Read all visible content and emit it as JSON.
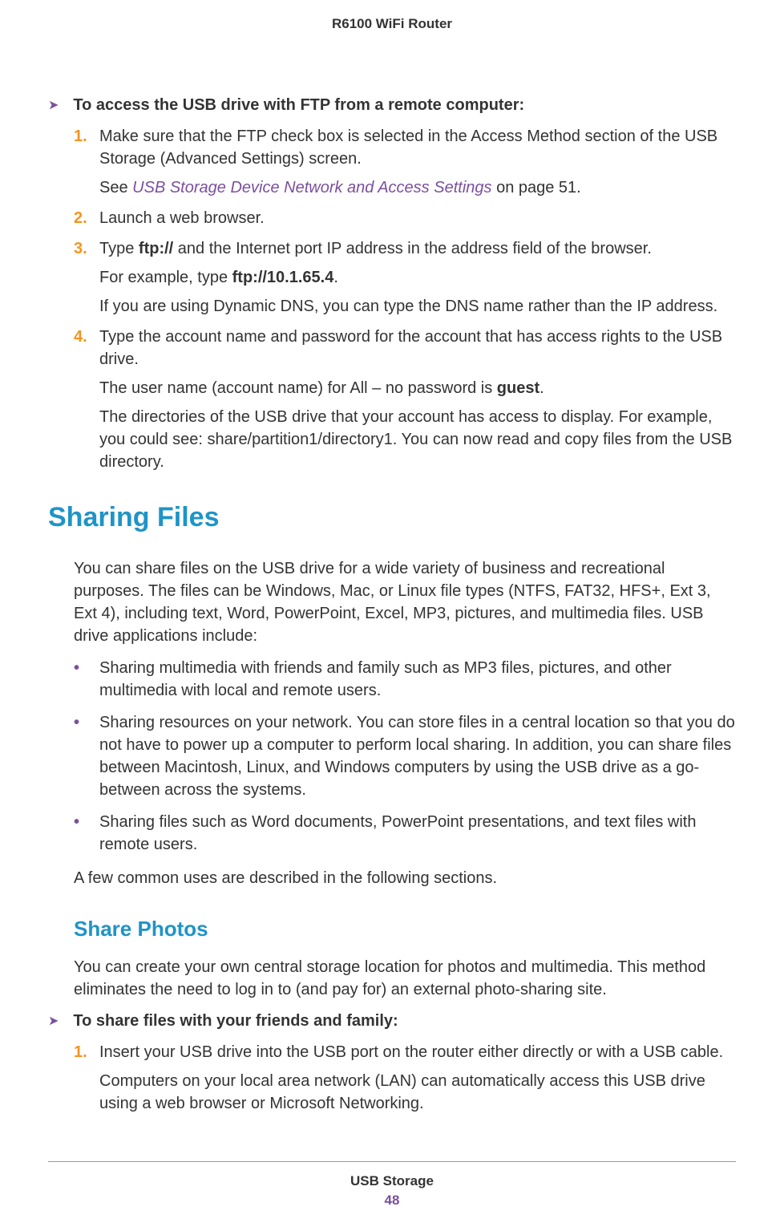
{
  "header": "R6100 WiFi Router",
  "procedure1": {
    "title": "To access the USB drive with FTP from a remote computer:",
    "steps": [
      {
        "num": "1.",
        "text": "Make sure that the FTP check box is selected in the Access Method section of the USB Storage (Advanced Settings) screen.",
        "after": [
          {
            "prefix": "See ",
            "link": "USB Storage Device Network and Access Settings",
            "suffix": " on page 51."
          }
        ]
      },
      {
        "num": "2.",
        "text": "Launch a web browser."
      },
      {
        "num": "3.",
        "pre": "Type ",
        "bold1": "ftp://",
        "post1": " and the Internet port IP address in the address field of the browser.",
        "after_plain": [
          {
            "pre": "For example, type ",
            "bold": "ftp://10.1.65.4",
            "post": "."
          },
          {
            "plain": "If you are using Dynamic DNS, you can type the DNS name rather than the IP address."
          }
        ]
      },
      {
        "num": "4.",
        "text": "Type the account name and password for the account that has access rights to the USB drive.",
        "after_plain": [
          {
            "pre": "The user name (account name) for All – no password is ",
            "bold": "guest",
            "post": "."
          },
          {
            "plain": "The directories of the USB drive that your account has access to display. For example, you could see: share/partition1/directory1. You can now read and copy files from the USB directory."
          }
        ]
      }
    ]
  },
  "h1": "Sharing Files",
  "sharing_intro": "You can share files on the USB drive for a wide variety of business and recreational purposes. The files can be Windows, Mac, or Linux file types (NTFS, FAT32, HFS+, Ext 3, Ext 4), including text, Word, PowerPoint, Excel, MP3, pictures, and multimedia files. USB drive applications include:",
  "bullets": [
    "Sharing multimedia with friends and family such as MP3 files, pictures, and other multimedia with local and remote users.",
    "Sharing resources on your network. You can store files in a central location so that you do not have to power up a computer to perform local sharing. In addition, you can share files between Macintosh, Linux, and Windows computers by using the USB drive as a go-between across the systems.",
    "Sharing files such as Word documents, PowerPoint presentations, and text files with remote users."
  ],
  "sharing_outro": "A few common uses are described in the following sections.",
  "h2": "Share Photos",
  "share_photos_intro": "You can create your own central storage location for photos and multimedia. This method eliminates the need to log in to (and pay for) an external photo-sharing site.",
  "procedure2": {
    "title": "To share files with your friends and family:",
    "steps": [
      {
        "num": "1.",
        "text": "Insert your USB drive into the USB port on the router either directly or with a USB cable.",
        "after_plain": [
          {
            "plain": "Computers on your local area network (LAN) can automatically access this USB drive using a web browser or Microsoft Networking."
          }
        ]
      }
    ]
  },
  "footer": {
    "title": "USB Storage",
    "page": "48"
  }
}
